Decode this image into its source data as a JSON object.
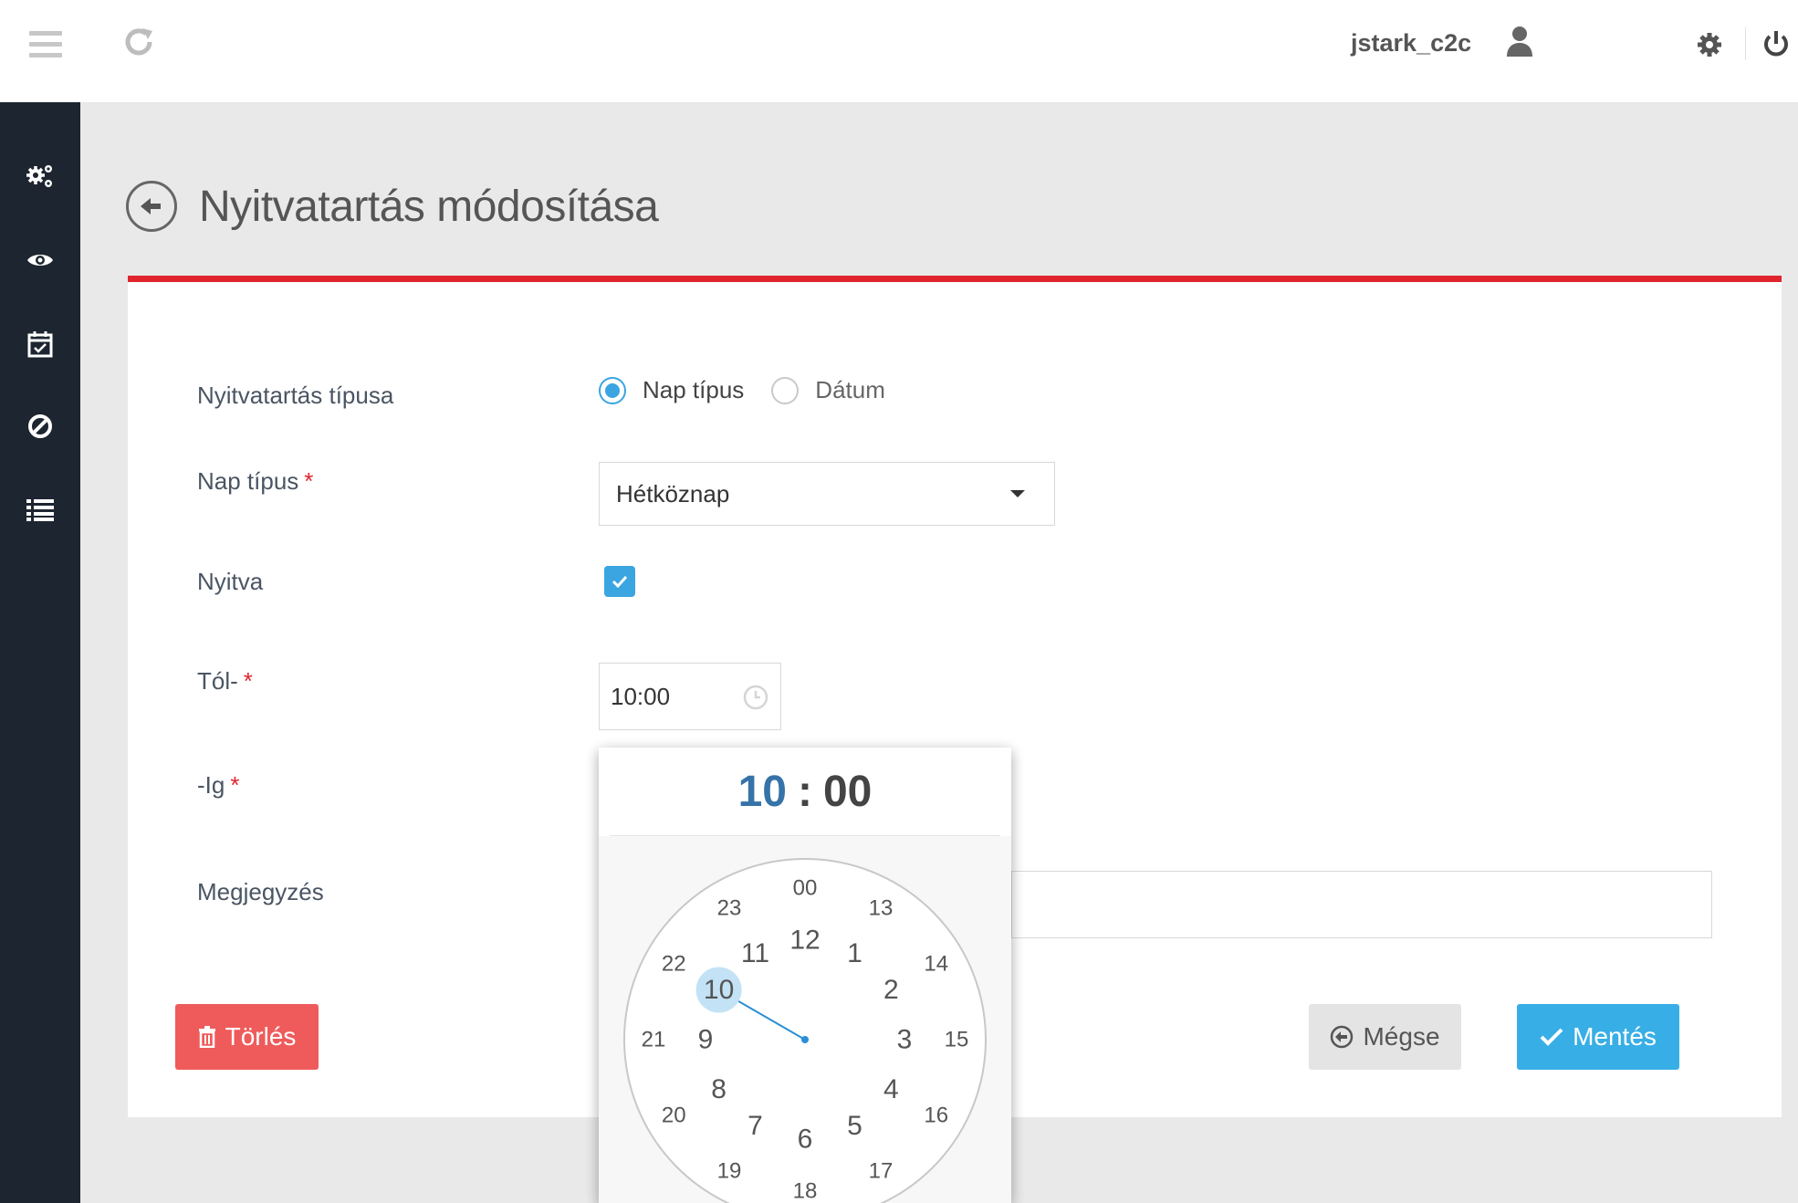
{
  "topbar": {
    "username": "jstark_c2c",
    "icons": [
      "hamburger-icon",
      "refresh-icon",
      "user-icon",
      "gear-icon",
      "power-icon"
    ]
  },
  "sidebar": {
    "items": [
      {
        "icon": "cogs-icon"
      },
      {
        "icon": "eye-icon"
      },
      {
        "icon": "calendar-check-icon"
      },
      {
        "icon": "ban-icon"
      },
      {
        "icon": "list-icon"
      }
    ]
  },
  "page": {
    "title": "Nyitvatartás módosítása"
  },
  "form": {
    "type_label": "Nyitvatartás típusa",
    "type_options": [
      "Nap típus",
      "Dátum"
    ],
    "type_selected": "Nap típus",
    "day_type_label": "Nap típus",
    "day_type_value": "Hétköznap",
    "required_mark": "*",
    "open_label": "Nyitva",
    "open_checked": true,
    "from_label": "Tól-",
    "from_value": "10:00",
    "to_label": "-Ig",
    "note_label": "Megjegyzés",
    "note_value": ""
  },
  "buttons": {
    "delete": "Törlés",
    "cancel": "Mégse",
    "save": "Mentés"
  },
  "clockpicker": {
    "hours": "10",
    "separator": ":",
    "minutes": "00",
    "selected_hour": 10,
    "outer_ring": [
      "00",
      "13",
      "14",
      "15",
      "16",
      "17",
      "18",
      "19",
      "20",
      "21",
      "22",
      "23"
    ],
    "inner_ring": [
      "12",
      "1",
      "2",
      "3",
      "4",
      "5",
      "6",
      "7",
      "8",
      "9",
      "10",
      "11"
    ]
  },
  "colors": {
    "accent": "#3aa5e0",
    "danger": "#ef5b5b",
    "header_rule": "#e0242e",
    "sidebar": "#1c2530",
    "hour_blue": "#3573a8"
  }
}
